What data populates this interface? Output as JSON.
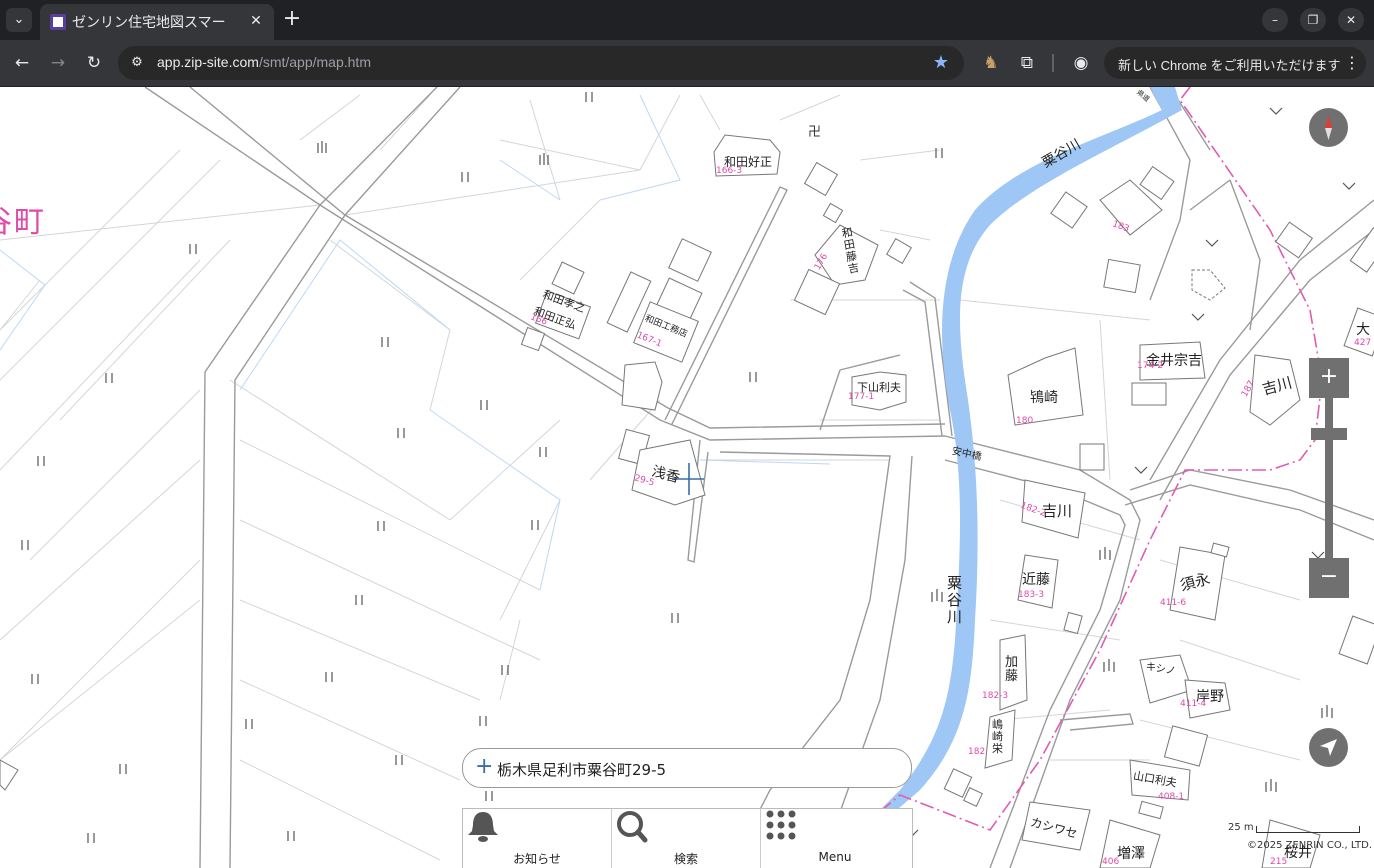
{
  "browser": {
    "tab_title": "ゼンリン住宅地図スマー",
    "url_host": "app.zip-site.com",
    "url_path": "/smt/app/map.htm",
    "update_label": "新しい Chrome をご利用いただけます",
    "icons": [
      "tab-list-icon",
      "close-icon",
      "new-tab-icon",
      "minimize-icon",
      "restore-icon",
      "window-close-icon",
      "back-icon",
      "forward-icon",
      "reload-icon",
      "site-info-icon",
      "bookmark-star-icon",
      "extension-icon",
      "puzzle-icon",
      "profile-icon",
      "more-icon"
    ]
  },
  "map": {
    "labels": {
      "town_name": "谷町",
      "river_name_1": "粟谷川",
      "river_name_2": "粟谷川",
      "bridge_name": "安中橋",
      "road_label": "県道",
      "temple_mark": "卍"
    },
    "buildings": [
      {
        "name": "和田好正",
        "number": "166-3"
      },
      {
        "name": "和田藤吉",
        "number": "176"
      },
      {
        "name": "和田孝之",
        "number": ""
      },
      {
        "name": "和田正弘",
        "number": "166"
      },
      {
        "name": "和田工務店",
        "number": "167-1"
      },
      {
        "name": "下山利夫",
        "number": "177-1"
      },
      {
        "name": "浅香",
        "number": "29-5"
      },
      {
        "name": "鴇崎",
        "number": "180"
      },
      {
        "name": "金井宗吉",
        "number": "174-2"
      },
      {
        "name": "吉川",
        "number": "187"
      },
      {
        "name": "吉川",
        "number": "182-2"
      },
      {
        "name": "近藤",
        "number": "183-3"
      },
      {
        "name": "加藤",
        "number": "182-3"
      },
      {
        "name": "嶋崎栄",
        "number": "182"
      },
      {
        "name": "須永",
        "number": "411-6"
      },
      {
        "name": "キシノ",
        "number": ""
      },
      {
        "name": "岸野",
        "number": "411-4"
      },
      {
        "name": "山口利夫",
        "number": "408-1"
      },
      {
        "name": "カシワセ",
        "number": ""
      },
      {
        "name": "増澤",
        "number": "406"
      },
      {
        "name": "桜井",
        "number": "215"
      },
      {
        "name": "大",
        "number": "427"
      },
      {
        "name": "",
        "number": "183"
      }
    ],
    "scale_label": "25 m",
    "copyright": "©2025 ZENRIN CO., LTD."
  },
  "controls": {
    "compass": "compass-icon",
    "zoom_in": "+",
    "zoom_out": "−",
    "locate": "locate-arrow-icon",
    "zoom_level": 0.85
  },
  "search": {
    "plus": "+",
    "address": "栃木県足利市粟谷町29-5"
  },
  "bottom_menu": [
    {
      "label": "お知らせ",
      "icon": "bell-icon"
    },
    {
      "label": "検索",
      "icon": "search-icon"
    },
    {
      "label": "Menu",
      "icon": "grid-menu-icon"
    }
  ],
  "colors": {
    "river": "#9ec7f5",
    "boundary": "#e05bb5",
    "lot_number": "#e04aa8",
    "road": "#9a9a9a",
    "control": "#707070",
    "chrome_dark": "#202124",
    "chrome_toolbar": "#35363a"
  }
}
